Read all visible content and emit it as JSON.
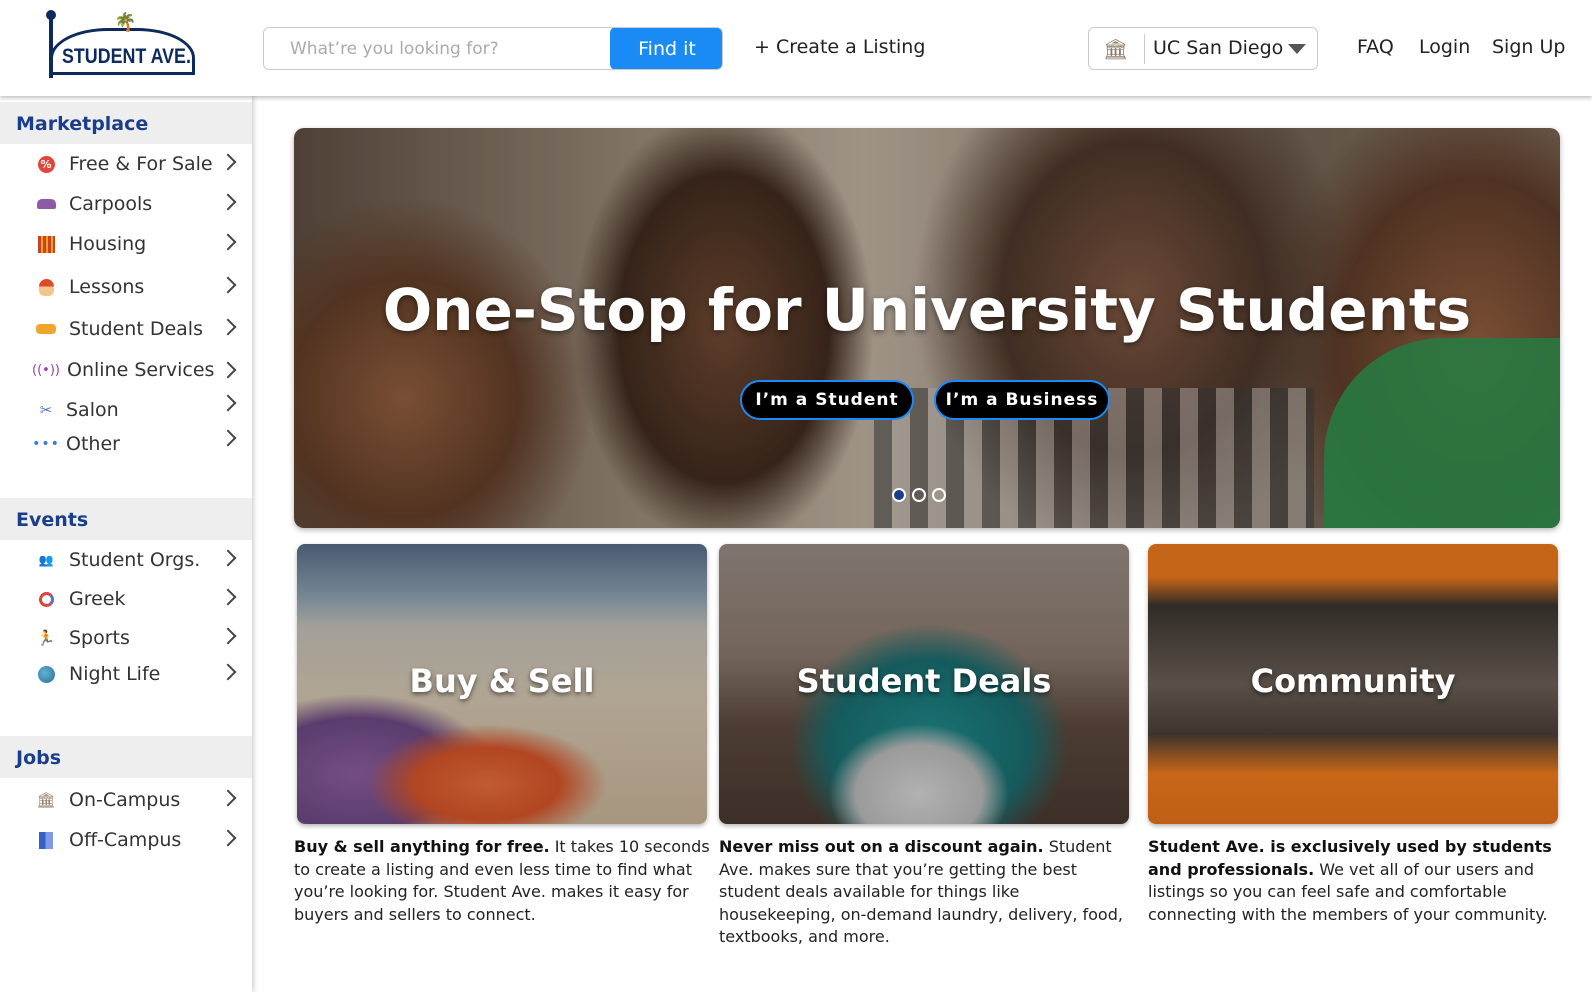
{
  "header": {
    "logo_text": "STUDENT AVE.",
    "search_placeholder": "What’re you looking for?",
    "find_label": "Find it",
    "create_label": "+ Create a Listing",
    "campus": "UC San Diego",
    "nav": [
      "FAQ",
      "Login",
      "Sign Up"
    ]
  },
  "sidebar": {
    "marketplace": {
      "title": "Marketplace",
      "items": [
        {
          "label": "Free & For Sale",
          "icon": "percent-badge-icon"
        },
        {
          "label": "Carpools",
          "icon": "car-icon"
        },
        {
          "label": "Housing",
          "icon": "building-icon"
        },
        {
          "label": "Lessons",
          "icon": "head-icon"
        },
        {
          "label": "Student Deals",
          "icon": "handshake-icon"
        },
        {
          "label": "Online Services",
          "icon": "broadcast-icon"
        },
        {
          "label": "Salon",
          "icon": "scissors-icon"
        },
        {
          "label": "Other",
          "icon": "ellipsis-icon"
        }
      ]
    },
    "events": {
      "title": "Events",
      "items": [
        {
          "label": "Student Orgs.",
          "icon": "people-icon"
        },
        {
          "label": "Greek",
          "icon": "greek-icon"
        },
        {
          "label": "Sports",
          "icon": "sports-icon"
        },
        {
          "label": "Night Life",
          "icon": "globe-icon"
        }
      ]
    },
    "jobs": {
      "title": "Jobs",
      "items": [
        {
          "label": "On-Campus",
          "icon": "institution-icon"
        },
        {
          "label": "Off-Campus",
          "icon": "office-icon"
        }
      ]
    }
  },
  "hero": {
    "title": "One-Stop for University Students",
    "student_button": "I’m a Student",
    "business_button": "I’m a Business",
    "slides": 3,
    "active_slide": 1
  },
  "cards": [
    {
      "label": "Buy & Sell",
      "lead": "Buy & sell anything for free.",
      "body": " It takes 10 seconds to create a listing and even less time to find what you’re looking for. Student Ave. makes it easy for buyers and sellers to connect."
    },
    {
      "label": "Student Deals",
      "lead": "Never miss out on a discount again.",
      "body": " Student Ave. makes sure that you’re getting the best student deals available for things like housekeeping, on-demand laundry, delivery, food, textbooks, and more."
    },
    {
      "label": "Community",
      "lead": "Student Ave. is exclusively used by students and professionals.",
      "body": " We vet all of our users and listings so you can feel safe and comfortable connecting with the members of your community."
    }
  ],
  "colors": {
    "brand_navy": "#0d2a5c",
    "accent_blue": "#1a8bf5",
    "section_heading": "#1b3e8a"
  }
}
